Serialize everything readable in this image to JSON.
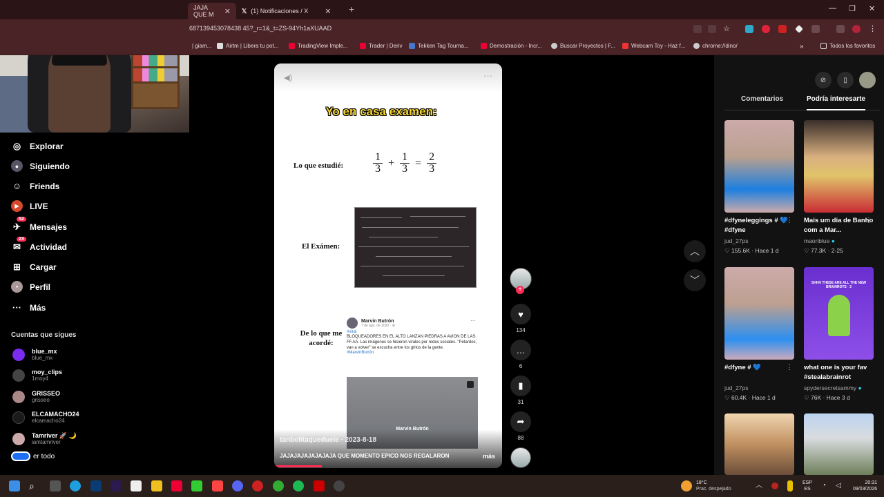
{
  "browser": {
    "tabs": [
      {
        "title": "JAJA QUE M",
        "active": true
      },
      {
        "title": "(1) Notificaciones / X",
        "active": false
      }
    ],
    "new_tab": "+",
    "url": "687139453078438 45?_r=1&_t=ZS-94Yh1aXUAAD",
    "bookmarks": [
      {
        "label": "| giam...",
        "color": "#888"
      },
      {
        "label": "Airtm | Libera tu pot...",
        "color": "#ddd"
      },
      {
        "label": "TradingView Imple...",
        "color": "#e03"
      },
      {
        "label": "Trader | Deriv",
        "color": "#e03"
      },
      {
        "label": "Tekken Tag Tourna...",
        "color": "#47c"
      },
      {
        "label": "Demostración - Incr...",
        "color": "#e03"
      },
      {
        "label": "Buscar Proyectos | F...",
        "color": "#ccc"
      },
      {
        "label": "Webcam Toy - Haz f...",
        "color": "#e33"
      },
      {
        "label": "chrome://dino/",
        "color": "#ccc"
      }
    ],
    "all_bookmarks": "Todos los favoritos"
  },
  "nav": {
    "items": [
      {
        "label": "Explorar",
        "icon": "compass-icon",
        "glyph": "◎"
      },
      {
        "label": "Siguiendo",
        "icon": "following-icon",
        "glyph": "●"
      },
      {
        "label": "Friends",
        "icon": "friends-icon",
        "glyph": "☺"
      },
      {
        "label": "LIVE",
        "icon": "live-icon",
        "glyph": "▶"
      },
      {
        "label": "Mensajes",
        "icon": "messages-icon",
        "glyph": "✈",
        "badge": "52"
      },
      {
        "label": "Actividad",
        "icon": "activity-icon",
        "glyph": "✉",
        "badge": "23"
      },
      {
        "label": "Cargar",
        "icon": "upload-icon",
        "glyph": "⊞"
      },
      {
        "label": "Perfil",
        "icon": "profile-icon",
        "glyph": "●"
      },
      {
        "label": "Más",
        "icon": "more-icon",
        "glyph": "···"
      }
    ],
    "following_title": "Cuentas que sigues",
    "following": [
      {
        "name": "blue_mx",
        "handle": "blue_mx",
        "color": "#7a2cf0"
      },
      {
        "name": "moy_clips",
        "handle": "1moy4",
        "color": "#444"
      },
      {
        "name": "GRISSEO",
        "handle": "grisseo",
        "color": "#a88"
      },
      {
        "name": "ELCAMACHO24",
        "handle": "elcamacho24",
        "color": "#111"
      },
      {
        "name": "Tamriver 🚀 🌙",
        "handle": "iamtamriver",
        "color": "#caa"
      }
    ],
    "see_all": "er todo"
  },
  "video": {
    "title": "Yo en casa examen:",
    "label_studied": "Lo que estudié:",
    "equation": {
      "a": "1",
      "b": "3",
      "c": "1",
      "d": "3",
      "e": "2",
      "f": "3"
    },
    "label_exam": "El Exámen:",
    "label_remember": "De lo que me acordé:",
    "post": {
      "author": "Marvin Butrón",
      "date": "7 de ago. de 2020 · ⊕",
      "hashtag": "#viral",
      "text": "BLOQUEADORES EN EL ALTO LANZAN PIEDRAS A AVION DE LAS FF.AA. Las imágenes se hicieron virales por redes sociales. \"Petardos, van a volver\" se escucha entre los gritos de la gente.",
      "tag2": "#MarvinButrón",
      "img_label": "Marvin Butrón"
    },
    "author_line": "tanbolitaqueduele · 2023-8-18",
    "caption": "JAJAJAJAJAJAJAJA QUE MOMENTO EPICO NOS REGALARON",
    "more": "más",
    "progress": 0.21
  },
  "actions": {
    "likes": "134",
    "comments": "6",
    "saves": "31",
    "shares": "88"
  },
  "panel": {
    "tabs": [
      "Comentarios",
      "Podría interesarte"
    ],
    "active_tab": 1,
    "cards": [
      {
        "desc": "#dfyneleggings # 💙 #dfyne",
        "user": "jud_27ps",
        "views": "155.6K",
        "when": "Hace 1 d",
        "bg": "linear-gradient(#caa 0%, #b9a08f 40%, #1d7fe0 75%, #caa 100%)"
      },
      {
        "desc": "Mais um dia de Banho com a Mar...",
        "user": "maoriblue",
        "views": "77.3K",
        "when": "2-25",
        "bg": "linear-gradient(#3a2f2a 0%, #d9b080 40%, #e0c46a 60%, #c92c35 100%)"
      },
      {
        "desc": "#dfyne # 💙",
        "user": "jud_27ps",
        "views": "60.4K",
        "when": "Hace 1 d",
        "bg": "linear-gradient(#caa 0%, #bda090 40%, #2c8ff0 78%, #cab 100%)"
      },
      {
        "desc": "what one is your fav #stealabrainrot",
        "user": "spydersecretsammy",
        "views": "76K",
        "when": "Hace 3 d",
        "bg": "linear-gradient(#6a2fd0, #8e4fe8)",
        "overlay": "SHHH THESE ARE ALL THE NEW BRAINROTS · 3"
      },
      {
        "desc": "",
        "user": "",
        "views": "",
        "when": "",
        "bg": "linear-gradient(#f0d6b0 0%, #c09060 50%, #6b4e3a 100%)"
      },
      {
        "desc": "",
        "user": "",
        "views": "",
        "when": "",
        "bg": "linear-gradient(#bcd4f0 0%, #d9dcdf 40%, #6e7f5a 100%)"
      }
    ]
  },
  "taskbar": {
    "weather_temp": "18°C",
    "weather_desc": "Prac. despejado",
    "lang": "ESP",
    "lang2": "ES",
    "time": "20:31",
    "date": "09/03/2026"
  }
}
